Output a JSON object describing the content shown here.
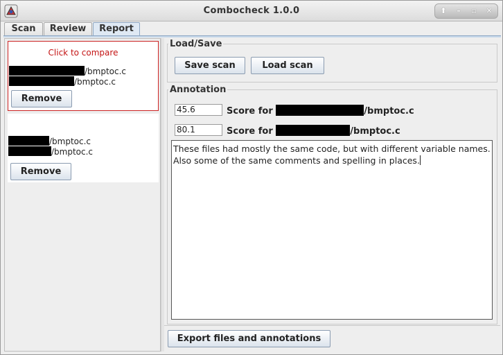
{
  "window": {
    "title": "Combocheck 1.0.0"
  },
  "icons": {
    "app": "app-icon",
    "maximize_up": "up-arrow-icon",
    "minimize": "minimize-icon",
    "maximize": "maximize-icon",
    "close": "close-icon"
  },
  "window_controls": {
    "up": "⬆",
    "minimize": "–",
    "maximize": "▫",
    "close": "✕"
  },
  "tabs": [
    {
      "label": "Scan"
    },
    {
      "label": "Review"
    },
    {
      "label": "Report"
    }
  ],
  "left": {
    "pairs": [
      {
        "header": "Click to compare",
        "file1": "/bmptoc.c",
        "file2": "/bmptoc.c",
        "remove_label": "Remove"
      },
      {
        "file1": "/bmptoc.c",
        "file2": "/bmptoc.c",
        "remove_label": "Remove"
      }
    ]
  },
  "load_save": {
    "title": "Load/Save",
    "save_label": "Save scan",
    "load_label": "Load scan"
  },
  "annotation": {
    "title": "Annotation",
    "scores": [
      {
        "value": "45.6",
        "label": "Score for",
        "file": "/bmptoc.c"
      },
      {
        "value": "80.1",
        "label": "Score for",
        "file": "/bmptoc.c"
      }
    ],
    "notes": [
      "These files had mostly the same code, but with different variable names.",
      "Also some of the same comments and spelling in places."
    ]
  },
  "export_label": "Export files and annotations"
}
